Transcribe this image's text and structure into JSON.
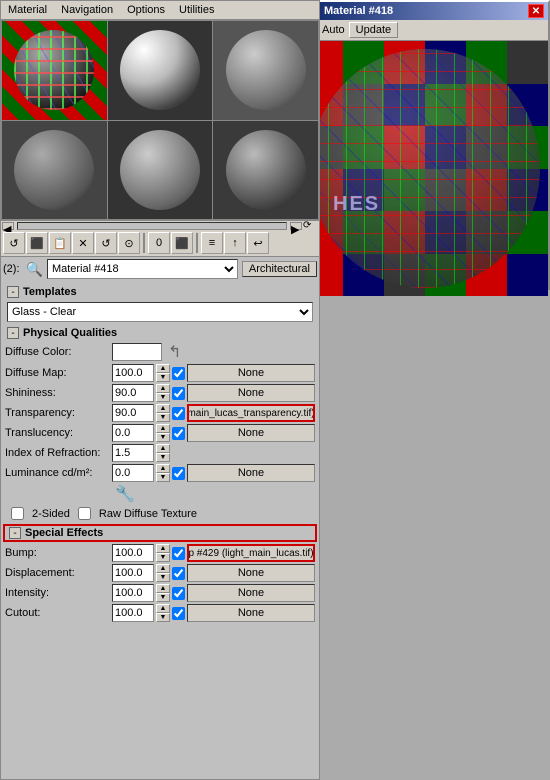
{
  "previewWindow": {
    "title": "Material #418",
    "titleIcon": "S",
    "autoLabel": "Auto",
    "updateLabel": "Update",
    "autoChecked": true
  },
  "mainPanel": {
    "menuItems": [
      "Material",
      "Navigation",
      "Options",
      "Utilities"
    ],
    "toolbar": {
      "buttons": [
        "↺",
        "⊞",
        "📋",
        "✕",
        "↺",
        "⚙",
        "0",
        "⬛",
        "≡",
        "↑",
        "↩"
      ]
    },
    "typeRow": {
      "label": "(2):",
      "iconLabel": "🔧",
      "dropdownValue": "Material #418",
      "typeLabel": "Architectural"
    },
    "templates": {
      "sectionLabel": "Templates",
      "dropdownValue": "Glass - Clear"
    },
    "physicalQualities": {
      "sectionLabel": "Physical Qualities",
      "diffuseColor": {
        "label": "Diffuse Color:",
        "color": "#ffffff"
      },
      "diffuseMap": {
        "label": "Diffuse Map:",
        "value": "100.0",
        "checked": true,
        "map": "None"
      },
      "shininess": {
        "label": "Shininess:",
        "value": "90.0",
        "checked": true,
        "map": "None"
      },
      "transparency": {
        "label": "Transparency:",
        "value": "90.0",
        "checked": true,
        "map": "main_lucas_transparency.tif)",
        "highlighted": true
      },
      "translucency": {
        "label": "Translucency:",
        "value": "0.0",
        "checked": true,
        "map": "None"
      },
      "indexOfRefraction": {
        "label": "Index of Refraction:",
        "value": "1.5"
      },
      "luminance": {
        "label": "Luminance cd/m²:",
        "value": "0.0",
        "checked": true,
        "map": "None"
      },
      "twoSided": "2-Sided",
      "rawDiffuse": "Raw Diffuse Texture"
    },
    "specialEffects": {
      "sectionLabel": "Special Effects",
      "highlighted": true,
      "bump": {
        "label": "Bump:",
        "value": "100.0",
        "checked": true,
        "map": "p #429 (light_main_lucas.tif)",
        "highlighted": true
      },
      "displacement": {
        "label": "Displacement:",
        "value": "100.0",
        "checked": true,
        "map": "None"
      },
      "intensity": {
        "label": "Intensity:",
        "value": "100.0",
        "checked": true,
        "map": "None"
      },
      "cutout": {
        "label": "Cutout:",
        "value": "100.0",
        "checked": true,
        "map": "None"
      }
    }
  }
}
